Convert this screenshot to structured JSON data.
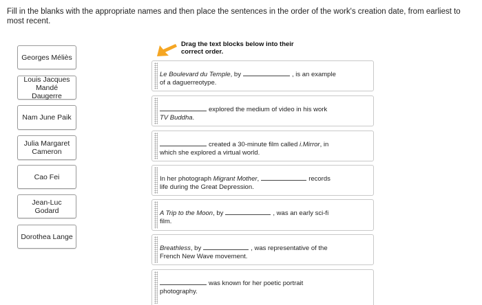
{
  "instruction": "Fill in the blanks with the appropriate names and then place the sentences in the order of the work's creation date, from earliest to most recent.",
  "drag_hint": "Drag the text blocks below into their correct order.",
  "icons": {
    "arrow": "arrow-icon",
    "grip": "drag-handle-icon",
    "arrow_color": "#f5a623"
  },
  "names": [
    "Georges Méliès",
    "Louis Jacques Mandé Daugerre",
    "Nam June Paik",
    "Julia Margaret Cameron",
    "Cao Fei",
    "Jean-Luc Godard",
    "Dorothea Lange"
  ],
  "sentences": [
    {
      "a": "Le Boulevard du Temple",
      "b": ", by",
      "c": ", is an example",
      "d": "of a daguerreotype."
    },
    {
      "a": "explored the medium of video in his work",
      "b": "TV Buddha",
      "c": "."
    },
    {
      "a": "created a 30-minute film called",
      "b": "i.Mirror",
      "c": ", in",
      "d": "which she explored a virtual world."
    },
    {
      "a": "In her photograph",
      "b": "Migrant Mother",
      "c": ",",
      "d": "records",
      "e": "life during the Great Depression."
    },
    {
      "a": "A Trip to the Moon",
      "b": ", by",
      "c": ", was an early sci-fi",
      "d": "film."
    },
    {
      "a": "Breathless",
      "b": ", by",
      "c": ", was representative of the",
      "d": "French New Wave movement."
    },
    {
      "a": "was known for her poetic portrait",
      "b": "photography."
    }
  ]
}
